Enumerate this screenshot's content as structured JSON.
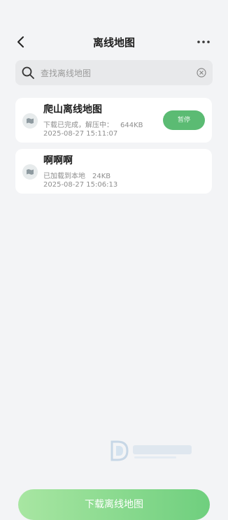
{
  "header": {
    "title": "离线地图"
  },
  "search": {
    "placeholder": "查找离线地图"
  },
  "maps": [
    {
      "name": "爬山离线地图",
      "status": "下载已完成，解压中：",
      "size": "644KB",
      "date": "2025-08-27 15:11:07",
      "action_label": "暂停"
    },
    {
      "name": "啊啊啊",
      "status": "已加载到本地",
      "size": "24KB",
      "date": "2025-08-27 15:06:13"
    }
  ],
  "download_button_label": "下载离线地图",
  "colors": {
    "accent": "#5bbb73",
    "card": "#ffffff",
    "background": "#f3f4f6"
  },
  "icons": [
    "back-arrow-icon",
    "more-icon",
    "search-icon",
    "clear-icon",
    "map-icon"
  ]
}
